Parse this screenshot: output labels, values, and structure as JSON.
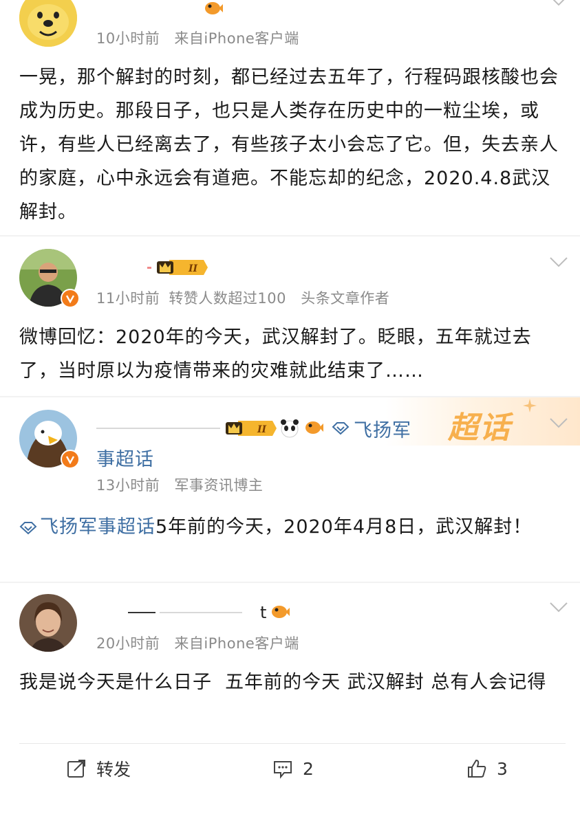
{
  "posts": [
    {
      "meta": {
        "time": "10小时前",
        "source": "来自iPhone客户端"
      },
      "text": "一晃，那个解封的时刻，都已经过去五年了，行程码跟核酸也会成为历史。那段日子，也只是人类存在历史中的一粒尘埃，或许，有些人已经离去了，有些孩子太小会忘了它。但，失去亲人的家庭，心中永远会有道疤。不能忘却的纪念，2020.4.8武汉解封。"
    },
    {
      "badge_level": "II",
      "meta": {
        "time": "11小时前",
        "info1": "转赞人数超过100",
        "info2": "头条文章作者"
      },
      "text": "微博回忆：2020年的今天，武汉解封了。眨眼，五年就过去了，当时原以为疫情带来的灾难就此结束了……"
    },
    {
      "badge_level": "II",
      "topic_head": "飞扬军",
      "topic_tail": "事超话",
      "banner": "超话",
      "meta": {
        "time": "13小时前",
        "info1": "军事资讯博主"
      },
      "topic_link": "飞扬军事超话",
      "text": "5年前的今天，2020年4月8日，武汉解封！"
    },
    {
      "name_fragment": "t",
      "meta": {
        "time": "20小时前",
        "source": "来自iPhone客户端"
      },
      "text": "我是说今天是什么日子  五年前的今天 武汉解封 总有人会记得"
    }
  ],
  "footer": {
    "repost": "转发",
    "comments": "2",
    "likes": "3"
  },
  "colors": {
    "link": "#3f6fa3",
    "meta": "#8a8a8a",
    "verified": "#f27b1a",
    "badge_gold": "#f5b52e"
  }
}
